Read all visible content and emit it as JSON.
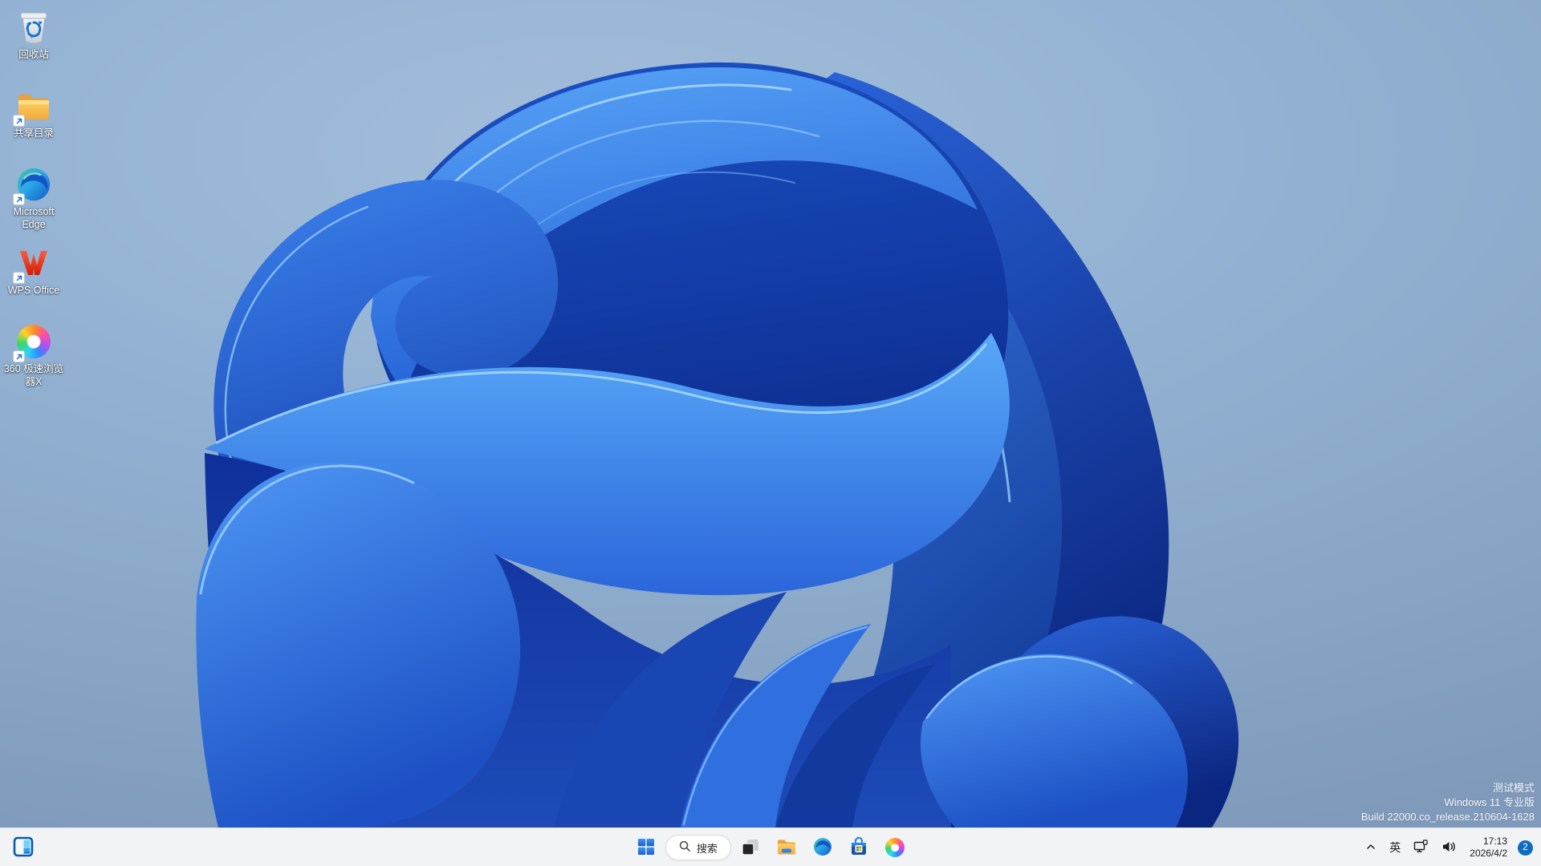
{
  "desktop": {
    "icons": [
      {
        "label": "回收站",
        "icon": "recycle-bin-icon",
        "shortcut": false
      },
      {
        "label": "共享目录",
        "icon": "folder-icon",
        "shortcut": true
      },
      {
        "label": "Microsoft Edge",
        "icon": "edge-icon",
        "shortcut": true
      },
      {
        "label": "WPS Office",
        "icon": "wps-office-icon",
        "shortcut": true
      },
      {
        "label": "360 极速浏览器X",
        "icon": "360-browser-icon",
        "shortcut": true
      }
    ],
    "watermark": {
      "lines": [
        "测试模式",
        "Windows 11 专业版",
        "Build 22000.co_release.210604-1628"
      ]
    }
  },
  "taskbar": {
    "widgets": {
      "icon": "widgets-icon"
    },
    "start": {
      "icon": "windows-start-icon"
    },
    "search": {
      "icon": "search-icon",
      "label": "搜索"
    },
    "pinned_icons": [
      "task-view-icon",
      "file-explorer-icon",
      "edge-icon",
      "microsoft-store-icon",
      "360-browser-icon"
    ],
    "tray": {
      "hidden_icons": {
        "icon": "chevron-up-icon"
      },
      "ime_label": "英",
      "network": {
        "icon": "network-ethernet-icon"
      },
      "volume": {
        "icon": "volume-icon"
      },
      "clock": {
        "time": "17:13",
        "date": "2026/4/2"
      },
      "notification_badge": "2"
    }
  },
  "colors": {
    "taskbar_bg": "#f2f3f5",
    "badge_accent": "#0f6cbd",
    "bloom_bright": "#4f9bf5",
    "bloom_mid": "#2a66d8",
    "bloom_dark": "#0e2f96",
    "bloom_highlight": "#a8d8ff",
    "background_sky": "#93b2d3"
  }
}
